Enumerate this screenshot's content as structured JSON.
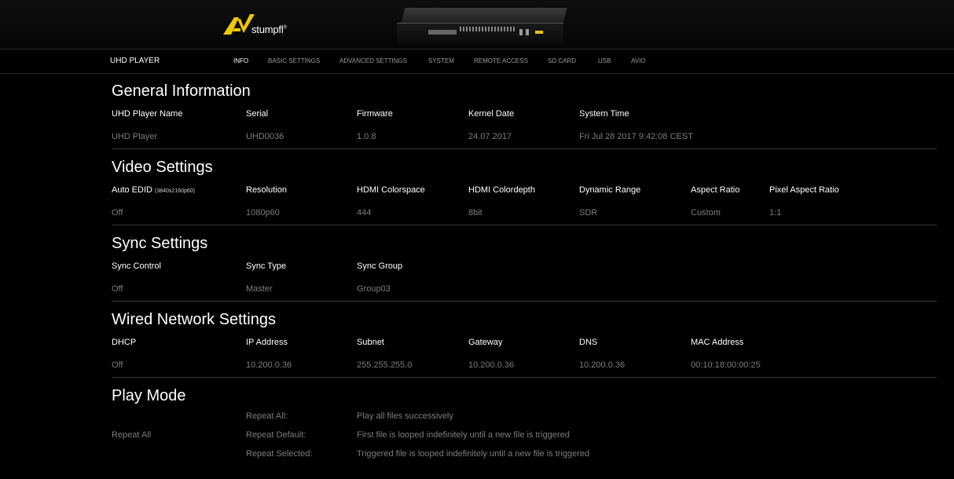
{
  "brand": {
    "name": "stumpfl",
    "mark": "®"
  },
  "nav": {
    "title": "UHD PLAYER",
    "items": [
      {
        "label": "INFO",
        "active": true
      },
      {
        "label": "BASIC SETTINGS"
      },
      {
        "label": "ADVANCED SETTINGS"
      },
      {
        "label": "SYSTEM"
      },
      {
        "label": "REMOTE ACCESS"
      },
      {
        "label": "SD CARD"
      },
      {
        "label": "USB"
      },
      {
        "label": "AVIO"
      }
    ]
  },
  "general": {
    "title": "General Information",
    "labels": [
      "UHD Player Name",
      "Serial",
      "Firmware",
      "Kernel Date",
      "System Time"
    ],
    "values": [
      "UHD Player",
      "UHD0036",
      "1.0.8",
      "24.07.2017",
      "Fri Jul 28 2017 9:42:08 CEST"
    ]
  },
  "video": {
    "title": "Video Settings",
    "labels": [
      "Auto EDID",
      "Resolution",
      "HDMI Colorspace",
      "HDMI Colordepth",
      "Dynamic Range",
      "Aspect Ratio",
      "Pixel Aspect Ratio"
    ],
    "edid_note": "(3840x2160p60)",
    "values": [
      "Off",
      "1080p60",
      "444",
      "8bit",
      "SDR",
      "Custom",
      "1:1"
    ]
  },
  "sync": {
    "title": "Sync Settings",
    "labels": [
      "Sync Control",
      "Sync Type",
      "Sync Group"
    ],
    "values": [
      "Off",
      "Master",
      "Group03"
    ]
  },
  "network": {
    "title": "Wired Network Settings",
    "labels": [
      "DHCP",
      "IP Address",
      "Subnet",
      "Gateway",
      "DNS",
      "MAC Address"
    ],
    "values": [
      "Off",
      "10.200.0.36",
      "255.255.255.0",
      "10.200.0.36",
      "10.200.0.36",
      "00:10:18:00:00:25"
    ]
  },
  "playmode": {
    "title": "Play Mode",
    "current": "Repeat All",
    "options": [
      {
        "name": "Repeat All:",
        "desc": "Play all files successively"
      },
      {
        "name": "Repeat Default:",
        "desc": "First file is looped indefinitely until a new file is triggered"
      },
      {
        "name": "Repeat Selected:",
        "desc": "Triggered file is looped indefinitely until a new file is triggered"
      }
    ]
  },
  "colors": {
    "accent": "#f0c800",
    "background": "#000000",
    "label": "#ffffff",
    "value": "#7c7c7c"
  }
}
